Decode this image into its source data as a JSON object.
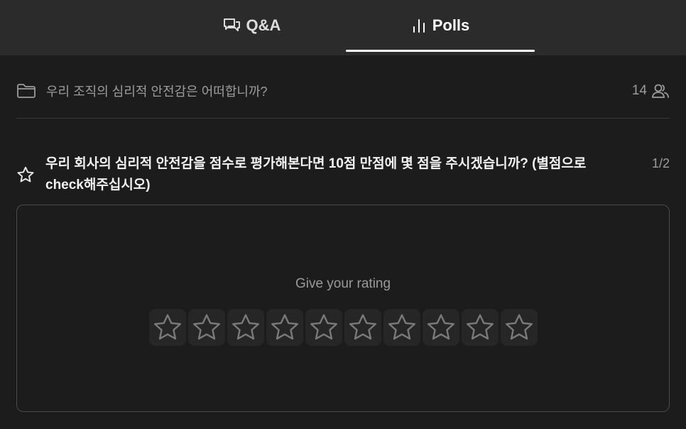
{
  "tabs": [
    {
      "label": "Q&A",
      "icon": "chat-bubble-icon",
      "active": false
    },
    {
      "label": "Polls",
      "icon": "bar-chart-icon",
      "active": true
    }
  ],
  "poll": {
    "title": "우리 조직의 심리적 안전감은 어떠합니까?",
    "participant_count": "14",
    "participants_icon": "users-icon",
    "folder_icon": "folder-icon"
  },
  "question": {
    "text": "우리 회사의 심리적 안전감을 점수로 평가해본다면 10점 만점에 몇 점을 주시겠습니까? (별점으로 check해주십시오)",
    "counter": "1/2",
    "icon": "star-outline-icon"
  },
  "rating": {
    "prompt": "Give your rating",
    "max_stars": 10,
    "selected": 0
  },
  "colors": {
    "background": "#1c1c1c",
    "tabbar": "#2b2b2b",
    "accent": "#ffffff",
    "muted_text": "#9c9c9c",
    "border": "#4a4a4a"
  }
}
